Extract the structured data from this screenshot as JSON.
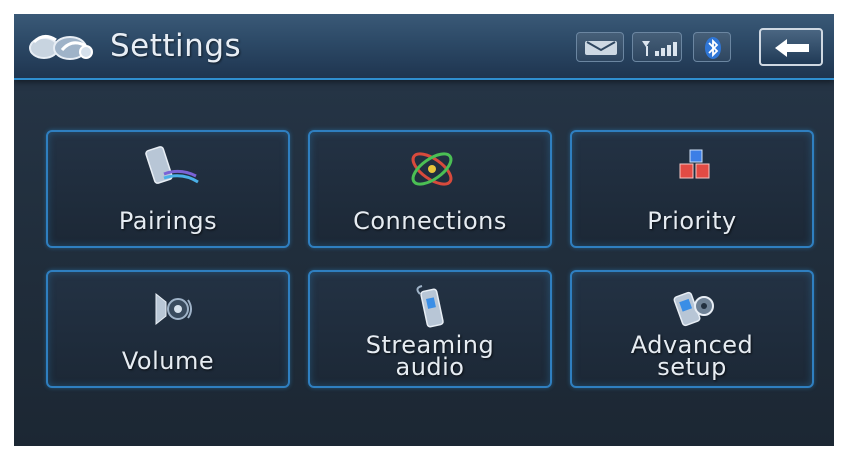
{
  "header": {
    "title": "Settings",
    "logo_icon": "bluetooth-logo-icon",
    "status_icons": [
      "sms-icon",
      "signal-strength-icon",
      "bluetooth-icon"
    ],
    "back_icon": "back-arrow-icon"
  },
  "menu": {
    "pairings": {
      "label": "Pairings",
      "icon": "phone-icon"
    },
    "connections": {
      "label": "Connections",
      "icon": "connections-icon"
    },
    "priority": {
      "label": "Priority",
      "icon": "priority-blocks-icon"
    },
    "volume": {
      "label": "Volume",
      "icon": "speaker-icon"
    },
    "streaming_audio": {
      "label_line1": "Streaming",
      "label_line2": "audio",
      "icon": "streaming-audio-icon"
    },
    "advanced_setup": {
      "label_line1": "Advanced",
      "label_line2": "setup",
      "icon": "advanced-setup-icon"
    }
  },
  "colors": {
    "accent": "#2f8fd0",
    "background": "#22303f",
    "text": "#e6ecf2"
  }
}
